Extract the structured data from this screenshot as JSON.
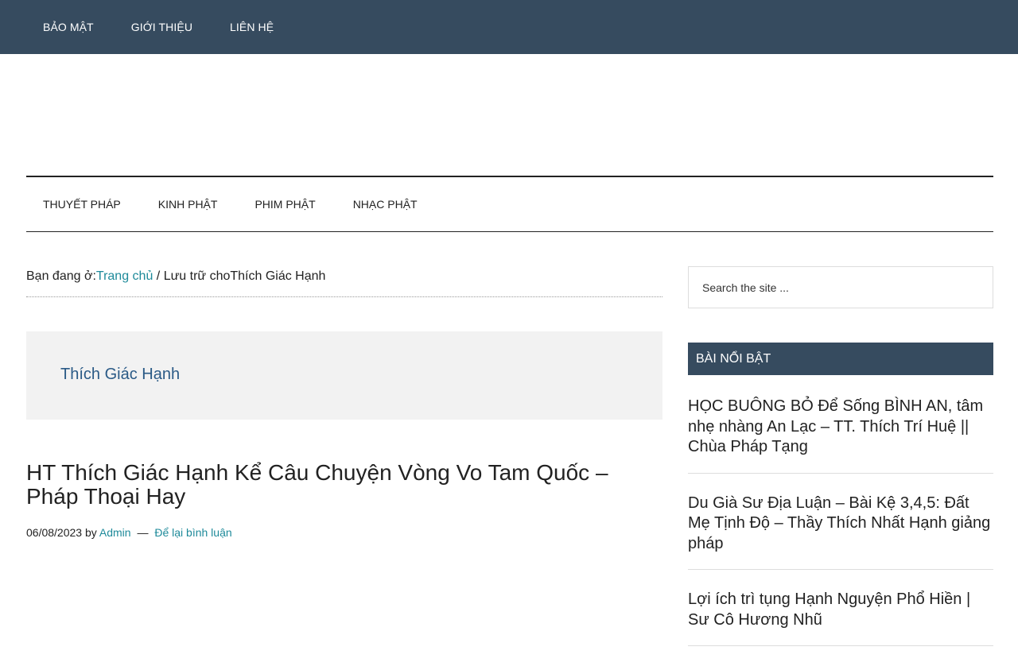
{
  "top_nav": {
    "items": [
      {
        "label": "BẢO MẬT"
      },
      {
        "label": "GIỚI THIỆU"
      },
      {
        "label": "LIÊN HỆ"
      }
    ]
  },
  "main_nav": {
    "items": [
      {
        "label": "THUYẾT PHÁP"
      },
      {
        "label": "KINH PHẬT"
      },
      {
        "label": "PHIM PHẬT"
      },
      {
        "label": "NHẠC PHẬT"
      }
    ]
  },
  "breadcrumb": {
    "prefix": "Bạn đang ở:",
    "home": "Trang chủ",
    "separator": " / ",
    "archive_prefix": "Lưu trữ cho",
    "current": "Thích Giác Hạnh"
  },
  "archive": {
    "title": "Thích Giác Hạnh"
  },
  "post": {
    "title": "HT Thích Giác Hạnh Kể Câu Chuyện Vòng Vo Tam Quốc – Pháp Thoại Hay",
    "date": "06/08/2023",
    "by": "by",
    "author": "Admin",
    "dash": "—",
    "comments": "Để lại bình luận"
  },
  "sidebar": {
    "search_placeholder": "Search the site ...",
    "widget_title": "BÀI NỔI BẬT",
    "featured": [
      {
        "title": "HỌC BUÔNG BỎ Để Sống BÌNH AN, tâm nhẹ nhàng An Lạc – TT. Thích Trí Huệ || Chùa Pháp Tạng"
      },
      {
        "title": "Du Già Sư Địa Luận – Bài Kệ 3,4,5: Đất Mẹ Tịnh Độ – Thầy Thích Nhất Hạnh giảng pháp"
      },
      {
        "title": "Lợi ích trì tụng Hạnh Nguyện Phổ Hiền | Sư Cô Hương Nhũ"
      }
    ]
  },
  "colors": {
    "topbar": "#364b5f",
    "link": "#1e8a9a",
    "archive_title": "#2a5a86",
    "archive_bg": "#f2f2f2"
  }
}
